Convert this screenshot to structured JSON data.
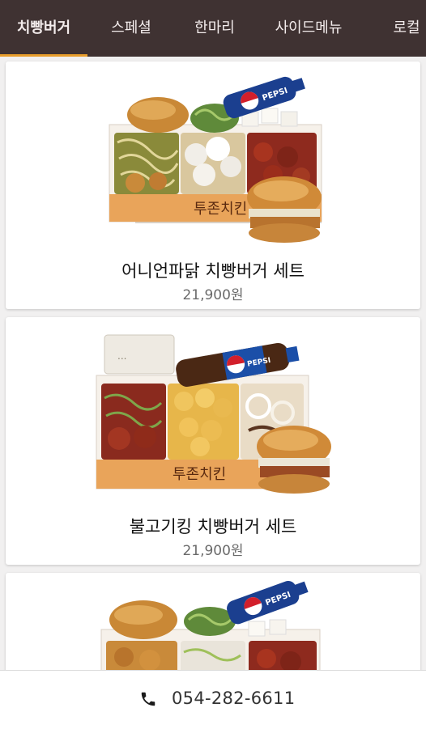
{
  "tabs": [
    {
      "label": "치빵버거"
    },
    {
      "label": "스페셜"
    },
    {
      "label": "한마리"
    },
    {
      "label": "사이드메뉴"
    },
    {
      "label": "로컬"
    }
  ],
  "products": [
    {
      "name": "어니언파닭 치빵버거 세트",
      "price": "21,900원",
      "drink_brand": "PEPSI"
    },
    {
      "name": "불고기킹 치빵버거 세트",
      "price": "21,900원",
      "drink_brand": "PEPSI"
    },
    {
      "drink_brand": "PEPSI"
    }
  ],
  "footer": {
    "phone": "054-282-6611",
    "icon": "phone-icon"
  },
  "colors": {
    "nav_bg": "#3f3232",
    "nav_text": "#f3ecec",
    "accent": "#e89d2c",
    "page_bg": "#f1f0f0",
    "price_text": "#6a6a6a"
  }
}
